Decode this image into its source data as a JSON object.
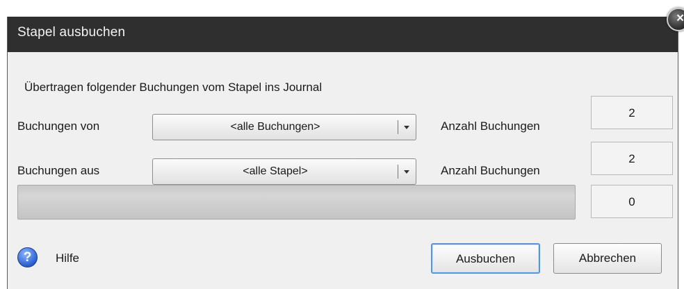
{
  "dialog": {
    "title": "Stapel ausbuchen",
    "intro": "Übertragen folgender Buchungen vom Stapel ins Journal"
  },
  "rows": [
    {
      "label": "Buchungen von",
      "combo_value": "<alle Buchungen>",
      "count_label": "Anzahl Buchungen",
      "count": "2"
    },
    {
      "label": "Buchungen aus",
      "combo_value": "<alle Stapel>",
      "count_label": "Anzahl Buchungen",
      "count": "2"
    }
  ],
  "progress": {
    "value": 0,
    "counter": "0"
  },
  "footer": {
    "help_label": "Hilfe",
    "help_icon": "help-icon",
    "ok_label": "Ausbuchen",
    "cancel_label": "Abbrechen"
  },
  "icons": {
    "close": "close-icon"
  },
  "colors": {
    "titlebar": "#2f2f2f",
    "body": "#f0f0f0",
    "focus": "#5a94d6"
  }
}
